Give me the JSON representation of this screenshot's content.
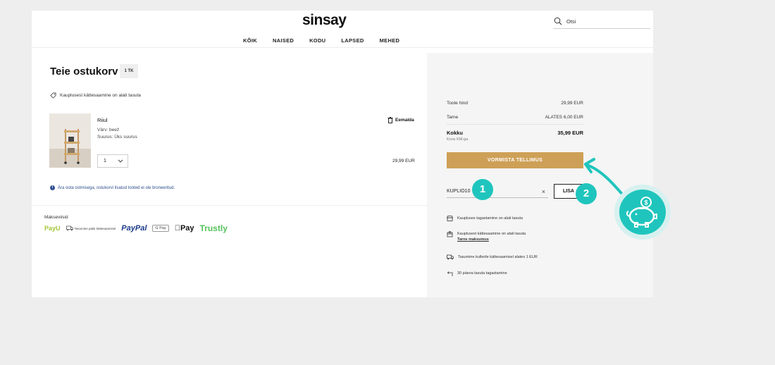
{
  "header": {
    "logo": "sinsay",
    "nav": [
      "KÕIK",
      "NAISED",
      "KODU",
      "LAPSED",
      "MEHED"
    ],
    "search_placeholder": "Otsi"
  },
  "cart": {
    "title": "Teie ostukorv",
    "count_badge": "1 TK",
    "pickup_note": "Kauplusest kättesaamine on alati tasuta",
    "item": {
      "name": "Riiul",
      "color": "Värv: beež",
      "size": "Suurus: Üks suurus",
      "quantity": "1",
      "remove_label": "Eemalda",
      "price": "29,99 EUR"
    },
    "info_note": "Ära oota ostmisega, ostukorvi lisatud tooted ei ole broneeritud."
  },
  "payment": {
    "label": "Makseviisid",
    "methods": [
      "PayU",
      "Tasumine pakk kättesaamisel",
      "PayPal",
      "G Pay",
      "Pay",
      "Trustly"
    ]
  },
  "summary": {
    "product_price_label": "Toote hind",
    "product_price": "29,99 EUR",
    "delivery_label": "Tarne",
    "delivery_value": "ALATES 6,00 EUR",
    "total_label": "Kokku",
    "total_value": "35,99 EUR",
    "vat_note": "Koos KM-ga",
    "checkout_label": "VORMISTA TELLIMUS",
    "coupon_value": "KUPLIO10",
    "apply_label": "LISA",
    "perks": [
      {
        "text": "Kaupluses tagastamine on alati tasuta"
      },
      {
        "text": "Kauplusest kättesaamine on alati tasuta",
        "link": "Tarne maksumus"
      },
      {
        "text": "Tasumine kullerile kättesaamisel alates 1 EUR"
      },
      {
        "text": "30 päeva tasuta tagastamine"
      }
    ]
  },
  "annotations": {
    "step1": "1",
    "step2": "2",
    "accent": "#1fc5bd"
  },
  "colors": {
    "checkout_button": "#cea057",
    "info_text": "#2d4f8f",
    "trustly": "#55c25a",
    "paypal": "#1b3a8a"
  }
}
